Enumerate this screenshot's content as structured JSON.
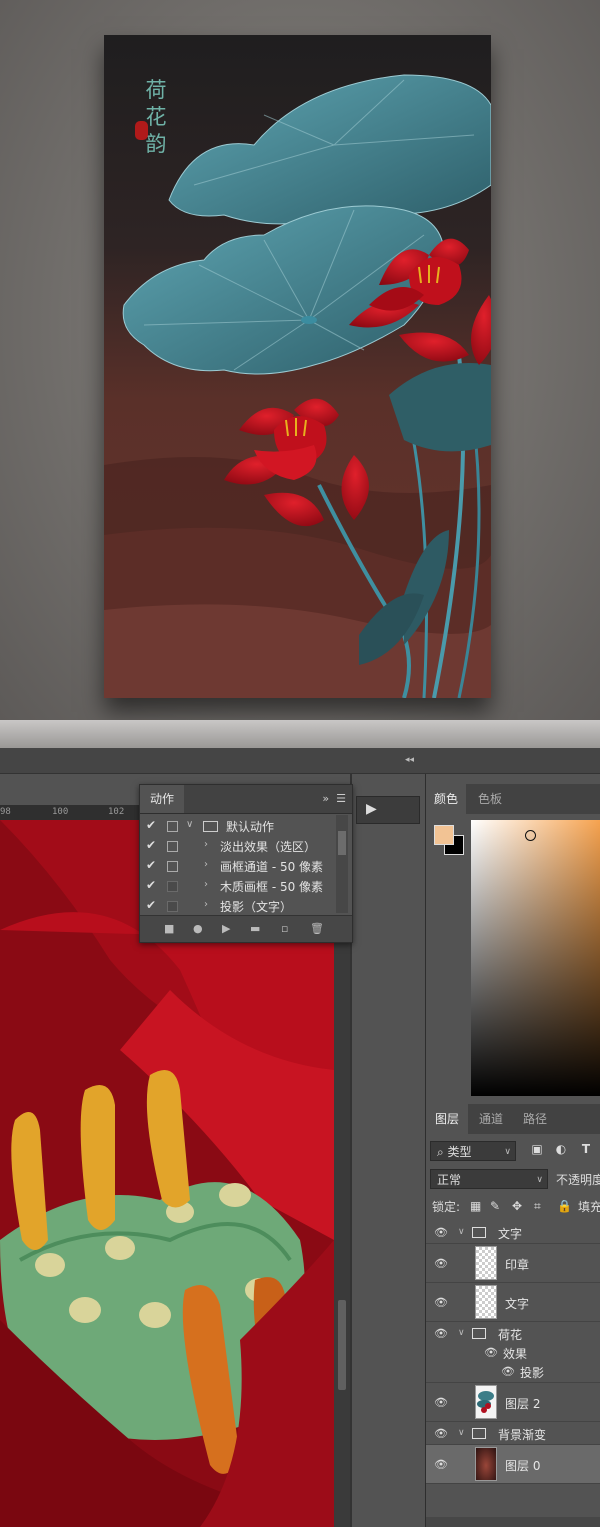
{
  "poster": {
    "title_chars": [
      "荷",
      "花",
      "韵"
    ]
  },
  "ruler": {
    "ticks": [
      "98",
      "100",
      "102"
    ]
  },
  "actions_panel": {
    "tab": "动作",
    "menu_glyph": "»",
    "items": [
      {
        "checked": true,
        "label": "默认动作",
        "is_set": true
      },
      {
        "checked": true,
        "label": "淡出效果（选区）"
      },
      {
        "checked": true,
        "label": "画框通道 - 50 像素"
      },
      {
        "checked": true,
        "label": "木质画框 - 50 像素"
      },
      {
        "checked": true,
        "label": "投影（文字）"
      }
    ]
  },
  "play_button_glyph": "▶",
  "color_panel": {
    "tabs": [
      "颜色",
      "色板"
    ],
    "foreground": "#f2c394",
    "background": "#000000",
    "picker_hue": "#f6a24e"
  },
  "layers_panel": {
    "tabs": [
      "图层",
      "通道",
      "路径"
    ],
    "filter_label": "类型",
    "blend_mode": "正常",
    "opacity_label": "不透明度",
    "lock_label": "锁定:",
    "fill_label": "填充",
    "filter_icons": [
      "image-icon",
      "adjust-icon",
      "T"
    ],
    "items": [
      {
        "name": "文字",
        "type": "group",
        "expanded": true
      },
      {
        "name": "印章",
        "type": "layer"
      },
      {
        "name": "文字",
        "type": "layer"
      },
      {
        "name": "荷花",
        "type": "group",
        "expanded": true
      },
      {
        "name": "效果",
        "type": "effects"
      },
      {
        "name": "投影",
        "type": "effect"
      },
      {
        "name": "图层 2",
        "type": "layer"
      },
      {
        "name": "背景渐变",
        "type": "group",
        "expanded": true
      },
      {
        "name": "图层 0",
        "type": "layer",
        "selected": true
      }
    ]
  }
}
